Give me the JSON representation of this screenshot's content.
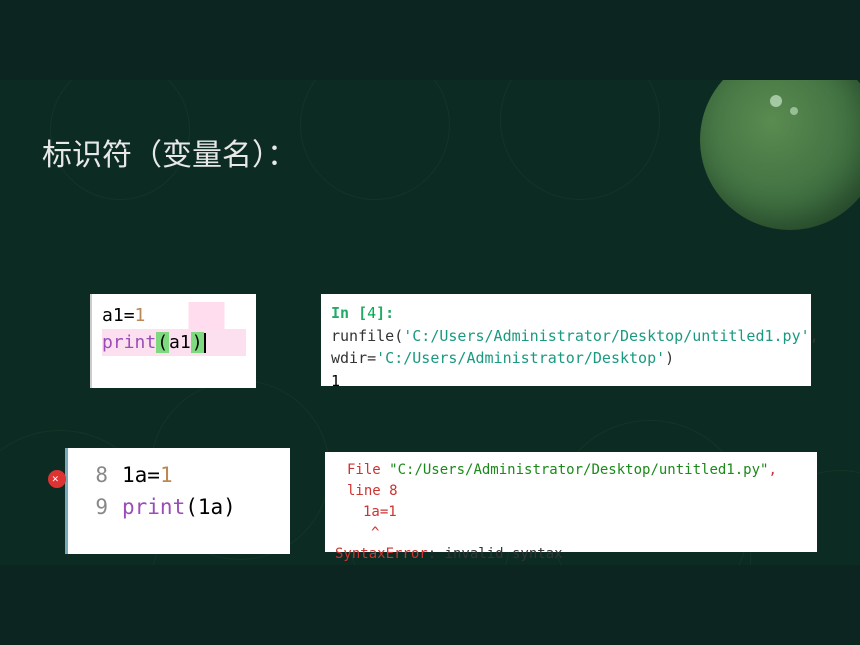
{
  "title": "标识符（变量名）：",
  "code1": {
    "line1_var": "a1",
    "line1_eq": "=",
    "line1_val": "1",
    "line2_func": "print",
    "line2_open": "(",
    "line2_arg": "a1",
    "line2_close": ")"
  },
  "console1": {
    "prompt": "In [",
    "prompt_num": "4",
    "prompt_close": "]: ",
    "func": "runfile",
    "open": "(",
    "str1": "'C:/Users/Administrator/Desktop/untitled1.py'",
    "comma": ",",
    "kwarg": "wdir=",
    "str2": "'C:/Users/Administrator/Desktop'",
    "close": ")",
    "output": "1"
  },
  "code2": {
    "ln1": "8",
    "ln2": "9",
    "line1_var": "1a",
    "line1_eq": "=",
    "line1_val": "1",
    "line2_func": "print",
    "line2_open": "(",
    "line2_arg": "1a",
    "line2_close": ")"
  },
  "error": {
    "file_label": "File ",
    "file_path": "\"C:/Users/Administrator/Desktop/untitled1.py\"",
    "line_label": ", line 8",
    "code": "1a=1",
    "caret": "^",
    "err_type": "SyntaxError",
    "err_sep": ": ",
    "err_msg": "invalid syntax"
  }
}
